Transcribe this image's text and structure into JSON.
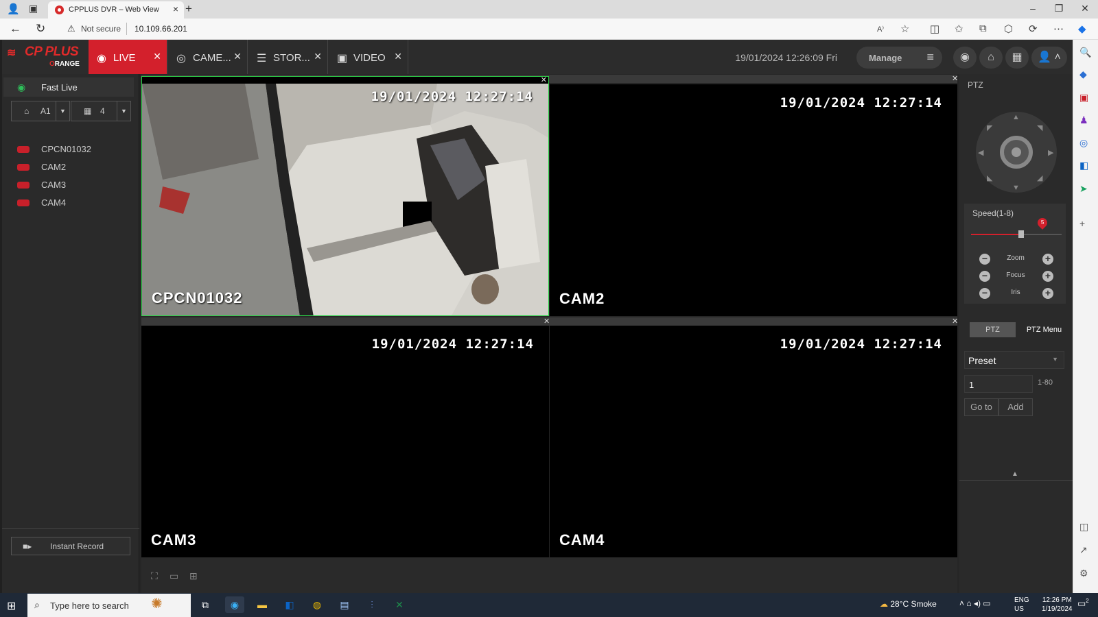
{
  "browser": {
    "tab_title": "CPPLUS DVR – Web View",
    "security": "Not secure",
    "url": "10.109.66.201"
  },
  "app": {
    "logo_brand": "CP PLUS",
    "logo_sub": "RANGE",
    "logo_sub_lead": "O",
    "tabs": [
      {
        "label": "LIVE",
        "active": true
      },
      {
        "label": "CAME...",
        "active": false
      },
      {
        "label": "STOR...",
        "active": false
      },
      {
        "label": "VIDEO",
        "active": false
      }
    ],
    "datetime": "19/01/2024 12:26:09 Fri",
    "manage_label": "Manage",
    "accent_color": "#d3202c",
    "selection_color": "#2fd34a"
  },
  "left_panel": {
    "fast_live": "Fast Live",
    "stream_select": "A1",
    "split_select": "4",
    "cameras": [
      "CPCN01032",
      "CAM2",
      "CAM3",
      "CAM4"
    ],
    "instant_record": "Instant Record"
  },
  "grid": {
    "tiles": [
      {
        "name": "CPCN01032",
        "timestamp": "19/01/2024 12:27:14",
        "selected": true
      },
      {
        "name": "CAM2",
        "timestamp": "19/01/2024 12:27:14",
        "selected": false
      },
      {
        "name": "CAM3",
        "timestamp": "19/01/2024 12:27:14",
        "selected": false
      },
      {
        "name": "CAM4",
        "timestamp": "19/01/2024 12:27:14",
        "selected": false
      }
    ]
  },
  "ptz": {
    "title": "PTZ",
    "speed_label": "Speed(1-8)",
    "speed_value": "5",
    "speed_fraction": 0.55,
    "zoom": "Zoom",
    "focus": "Focus",
    "iris": "Iris",
    "tab_ptz": "PTZ",
    "tab_menu": "PTZ Menu",
    "preset_select": "Preset",
    "preset_value": "1",
    "preset_range": "1-80",
    "goto_label": "Go to",
    "add_label": "Add"
  },
  "taskbar": {
    "search_placeholder": "Type here to search",
    "weather": "28°C  Smoke",
    "lang1": "ENG",
    "lang2": "US",
    "time": "12:26 PM",
    "date": "1/19/2024",
    "notif_count": "2"
  }
}
